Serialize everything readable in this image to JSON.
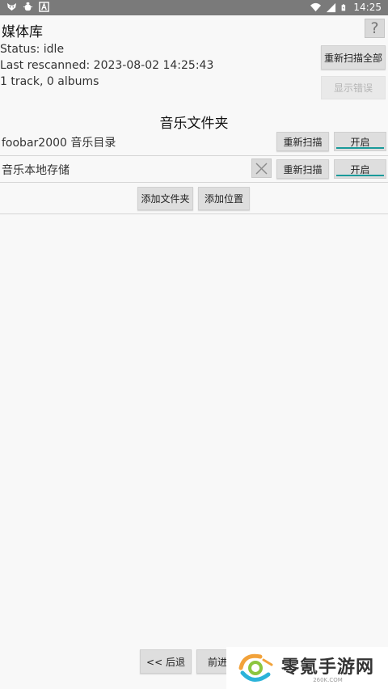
{
  "status_bar": {
    "time": "14:25",
    "left_icons": [
      "fox-icon",
      "bug-icon",
      "a-icon"
    ],
    "right_icons": [
      "wifi-icon",
      "signal-icon",
      "battery-icon"
    ]
  },
  "header": {
    "title": "媒体库",
    "help_label": "?",
    "status": "Status: idle",
    "last_rescanned": "Last rescanned: 2023-08-02 14:25:43",
    "counts": "1 track, 0 albums",
    "rescan_all_label": "重新扫描全部",
    "show_errors_label": "显示错误"
  },
  "folders": {
    "section_title": "音乐文件夹",
    "items": [
      {
        "name": "foobar2000 音乐目录",
        "rescan_label": "重新扫描",
        "toggle_label": "开启"
      },
      {
        "name": "音乐本地存储",
        "rescan_label": "重新扫描",
        "toggle_label": "开启"
      }
    ],
    "add_folder_label": "添加文件夹",
    "add_location_label": "添加位置"
  },
  "nav": {
    "back_label": "<< 后退",
    "forward_label": "前进"
  },
  "watermark": {
    "text": "零氪手游网",
    "sub": "260K.COM"
  },
  "colors": {
    "accent": "#1a9a9a",
    "status_bar": "#7a7a7a",
    "background": "#f8f8f8"
  }
}
